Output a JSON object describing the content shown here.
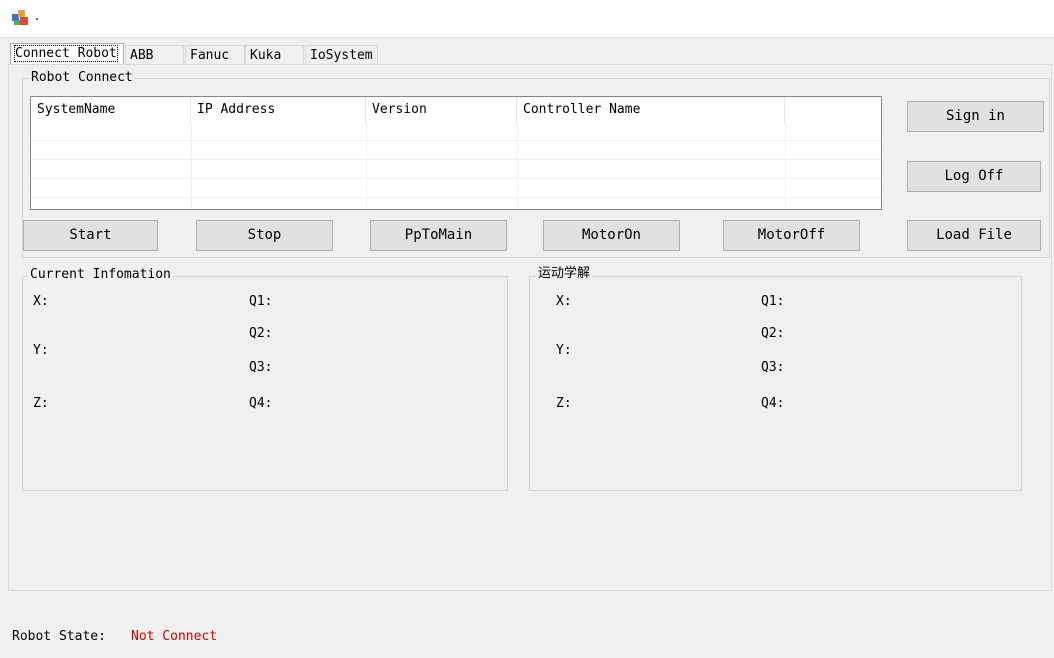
{
  "window": {
    "title": "."
  },
  "tabs": [
    {
      "label": "Connect Robot",
      "active": true
    },
    {
      "label": "ABB"
    },
    {
      "label": "Fanuc"
    },
    {
      "label": "Kuka"
    },
    {
      "label": "IoSystem"
    }
  ],
  "robot_connect": {
    "legend": "Robot Connect",
    "columns": [
      "SystemName",
      "IP Address",
      "Version",
      "Controller Name"
    ],
    "rows": []
  },
  "buttons": {
    "sign_in": "Sign in",
    "log_off": "Log Off",
    "start": "Start",
    "stop": "Stop",
    "pp_to_main": "PpToMain",
    "motor_on": "MotorOn",
    "motor_off": "MotorOff",
    "load_file": "Load File"
  },
  "current_info": {
    "legend": "Current Infomation",
    "labels": {
      "x": "X:",
      "y": "Y:",
      "z": "Z:",
      "q1": "Q1:",
      "q2": "Q2:",
      "q3": "Q3:",
      "q4": "Q4:"
    }
  },
  "kinematics": {
    "legend": "运动学解",
    "labels": {
      "x": "X:",
      "y": "Y:",
      "z": "Z:",
      "q1": "Q1:",
      "q2": "Q2:",
      "q3": "Q3:",
      "q4": "Q4:"
    }
  },
  "status": {
    "label": "Robot State:",
    "value": "Not Connect",
    "value_color": "#cc0000"
  }
}
